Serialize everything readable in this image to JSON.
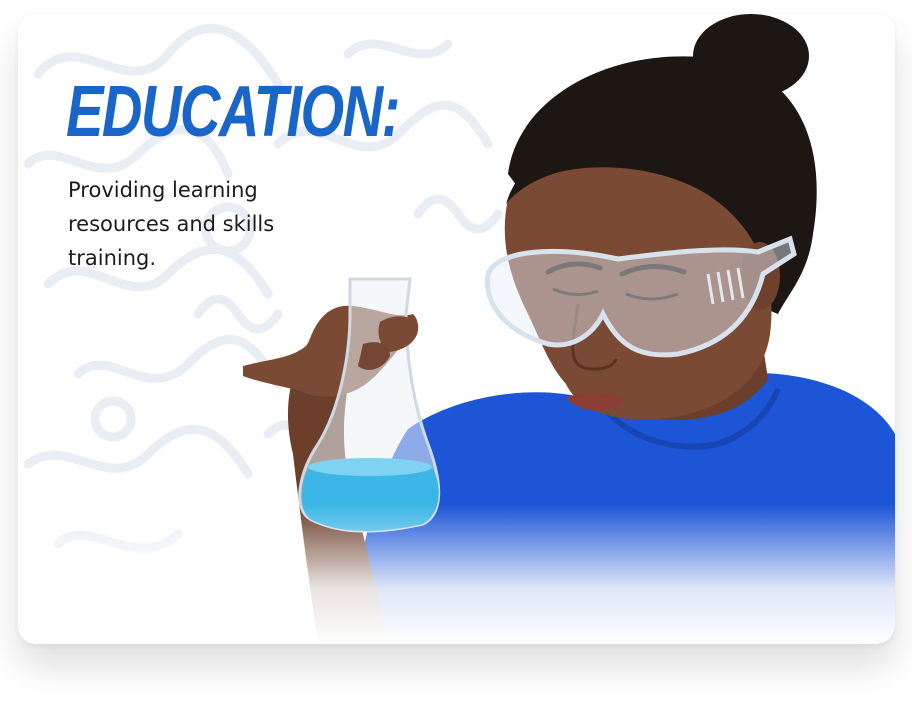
{
  "card": {
    "title": "EDUCATION:",
    "description": "Providing learning resources and skills training."
  },
  "colors": {
    "accent": "#1a66c8",
    "shirt": "#1c55d6",
    "liquid": "#3bb6e6",
    "skin": "#7a4a34",
    "hair": "#1d1713"
  },
  "image": {
    "subject": "girl-with-safety-goggles-holding-flask-icon"
  }
}
